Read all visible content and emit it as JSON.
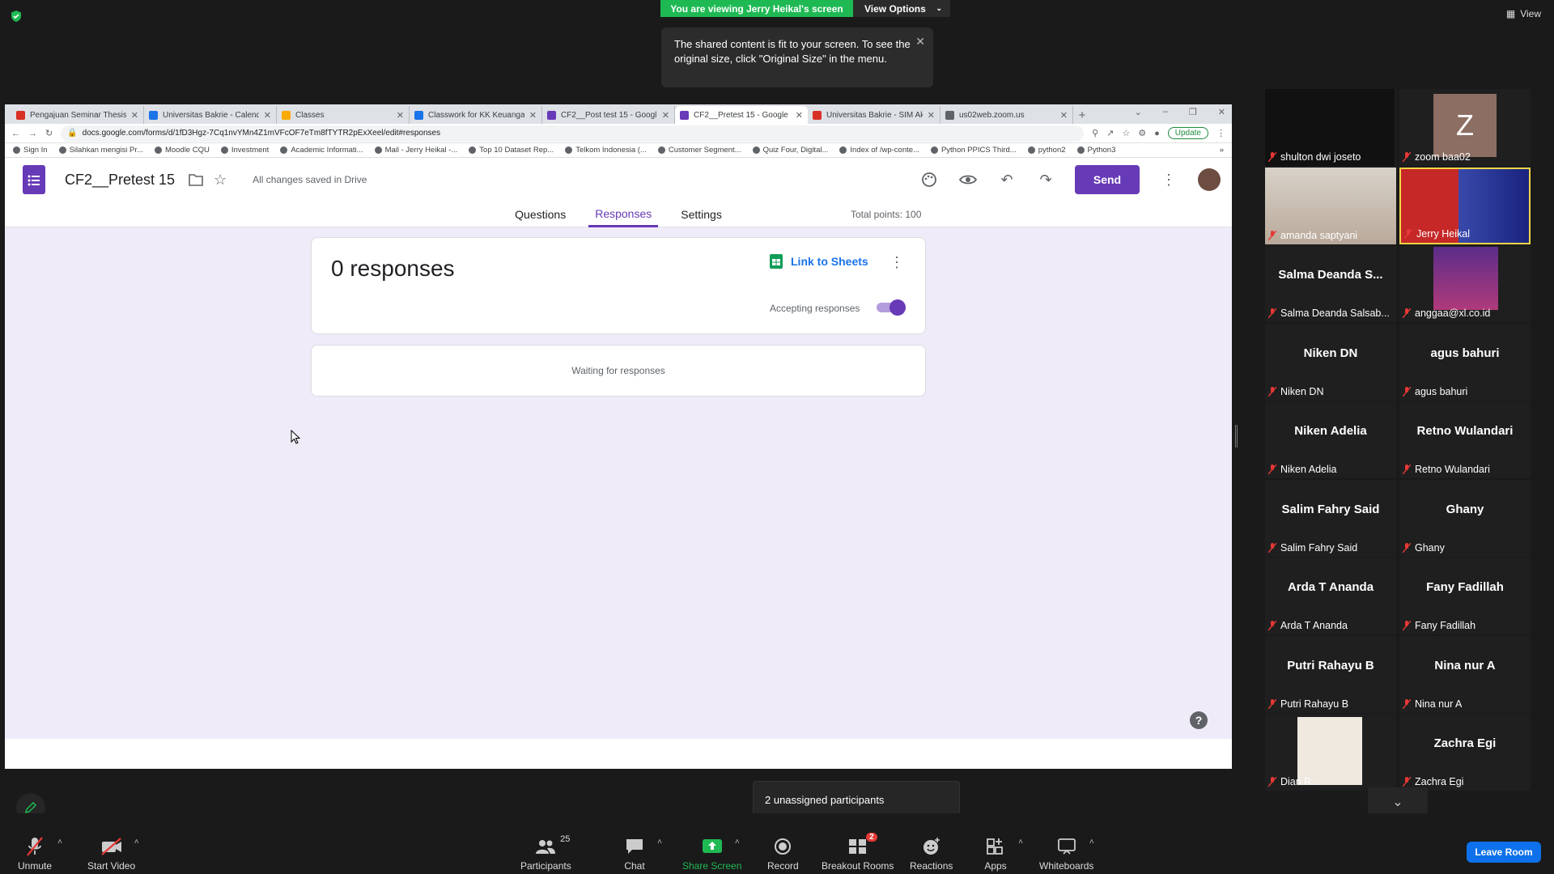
{
  "zoom": {
    "viewing_banner": "You are viewing Jerry Heikal's screen",
    "view_options": "View Options",
    "tooltip_text": "The shared content is fit to your screen. To see the original size, click \"Original Size\" in the menu.",
    "view_label": "View",
    "unassigned": "2 unassigned participants",
    "leave_room": "Leave Room",
    "toolbar": {
      "unmute": "Unmute",
      "start_video": "Start Video",
      "participants": "Participants",
      "participants_count": "25",
      "chat": "Chat",
      "share_screen": "Share Screen",
      "record": "Record",
      "breakout_rooms": "Breakout Rooms",
      "breakout_badge": "2",
      "reactions": "Reactions",
      "apps": "Apps",
      "whiteboards": "Whiteboards"
    },
    "gallery": [
      {
        "label": "shulton dwi joseto",
        "big": "",
        "type": "photo"
      },
      {
        "label": "zoom baa02",
        "big": "",
        "type": "avatar",
        "initial": "Z"
      },
      {
        "label": "amanda saptyani",
        "big": "",
        "type": "photo"
      },
      {
        "label": "Jerry Heikal",
        "big": "",
        "type": "photo",
        "highlight": true
      },
      {
        "label": "Salma Deanda Salsab...",
        "big": "Salma  Deanda  S...",
        "type": "name"
      },
      {
        "label": "anggaa@xl.co.id",
        "big": "",
        "type": "photo"
      },
      {
        "label": "Niken DN",
        "big": "Niken DN",
        "type": "name"
      },
      {
        "label": "agus bahuri",
        "big": "agus bahuri",
        "type": "name"
      },
      {
        "label": "Niken Adelia",
        "big": "Niken Adelia",
        "type": "name"
      },
      {
        "label": "Retno Wulandari",
        "big": "Retno Wulandari",
        "type": "name"
      },
      {
        "label": "Salim Fahry Said",
        "big": "Salim Fahry Said",
        "type": "name"
      },
      {
        "label": "Ghany",
        "big": "Ghany",
        "type": "name"
      },
      {
        "label": "Arda T Ananda",
        "big": "Arda T Ananda",
        "type": "name"
      },
      {
        "label": "Fany Fadillah",
        "big": "Fany Fadillah",
        "type": "name"
      },
      {
        "label": "Putri Rahayu B",
        "big": "Putri Rahayu B",
        "type": "name"
      },
      {
        "label": "Nina nur A",
        "big": "Nina nur A",
        "type": "name"
      },
      {
        "label": "Dian R...",
        "big": "",
        "type": "photo"
      },
      {
        "label": "Zachra Egi",
        "big": "Zachra Egi",
        "type": "name"
      }
    ]
  },
  "browser": {
    "tabs": [
      {
        "title": "Pengajuan Seminar Thesis",
        "color": "#d93025"
      },
      {
        "title": "Universitas Bakrie - Calend",
        "color": "#1a73e8"
      },
      {
        "title": "Classes",
        "color": "#f9ab00"
      },
      {
        "title": "Classwork for KK Keuanga",
        "color": "#1a73e8"
      },
      {
        "title": "CF2__Post test 15 - Googl",
        "color": "#673ab7"
      },
      {
        "title": "CF2__Pretest 15 - Google",
        "color": "#673ab7",
        "active": true
      },
      {
        "title": "Universitas Bakrie - SIM Ak",
        "color": "#d93025"
      },
      {
        "title": "us02web.zoom.us",
        "color": "#5f6368"
      }
    ],
    "url": "docs.google.com/forms/d/1fD3Hgz-7Cq1nvYMn4Z1mVFcOF7eTm8fTYTR2pExXeel/edit#responses",
    "update_label": "Update",
    "bookmarks": [
      "Sign In",
      "Silahkan mengisi Pr...",
      "Moodle CQU",
      "Investment",
      "Academic Informati...",
      "Mail - Jerry Heikal -...",
      "Top 10 Dataset Rep...",
      "Telkom Indonesia (...",
      "Customer Segment...",
      "Quiz Four, Digital...",
      "Index of /wp-conte...",
      "Python PPICS Third...",
      "python2",
      "Python3"
    ]
  },
  "form": {
    "title": "CF2__Pretest 15",
    "saved_status": "All changes saved in Drive",
    "send_label": "Send",
    "tabs": [
      "Questions",
      "Responses",
      "Settings"
    ],
    "active_tab": "Responses",
    "total_points": "Total points: 100",
    "responses_count": "0 responses",
    "link_to_sheets": "Link to Sheets",
    "accepting_label": "Accepting responses",
    "accepting_responses": true,
    "waiting_text": "Waiting for responses"
  }
}
